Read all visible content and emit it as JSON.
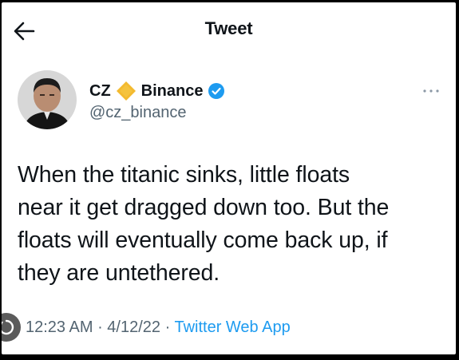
{
  "header": {
    "title": "Tweet",
    "back_icon": "arrow-left-icon"
  },
  "author": {
    "name": "CZ",
    "badge_icon": "binance-diamond-icon",
    "org": "Binance",
    "verified_icon": "verified-badge-icon",
    "handle": "@cz_binance",
    "more_icon": "more-horizontal-icon"
  },
  "tweet": {
    "lines": [
      "When the titanic sinks, little floats",
      "near it get dragged down too. But the",
      "floats will eventually come back up, if",
      "they are untethered."
    ]
  },
  "meta": {
    "time": "12:23 AM",
    "separator": " · ",
    "date": "4/12/22",
    "source": "Twitter Web App"
  },
  "colors": {
    "text": "#0f1419",
    "secondary": "#536471",
    "link": "#1d9bf0",
    "verified": "#1d9bf0",
    "binance": "#f3ba2f"
  }
}
